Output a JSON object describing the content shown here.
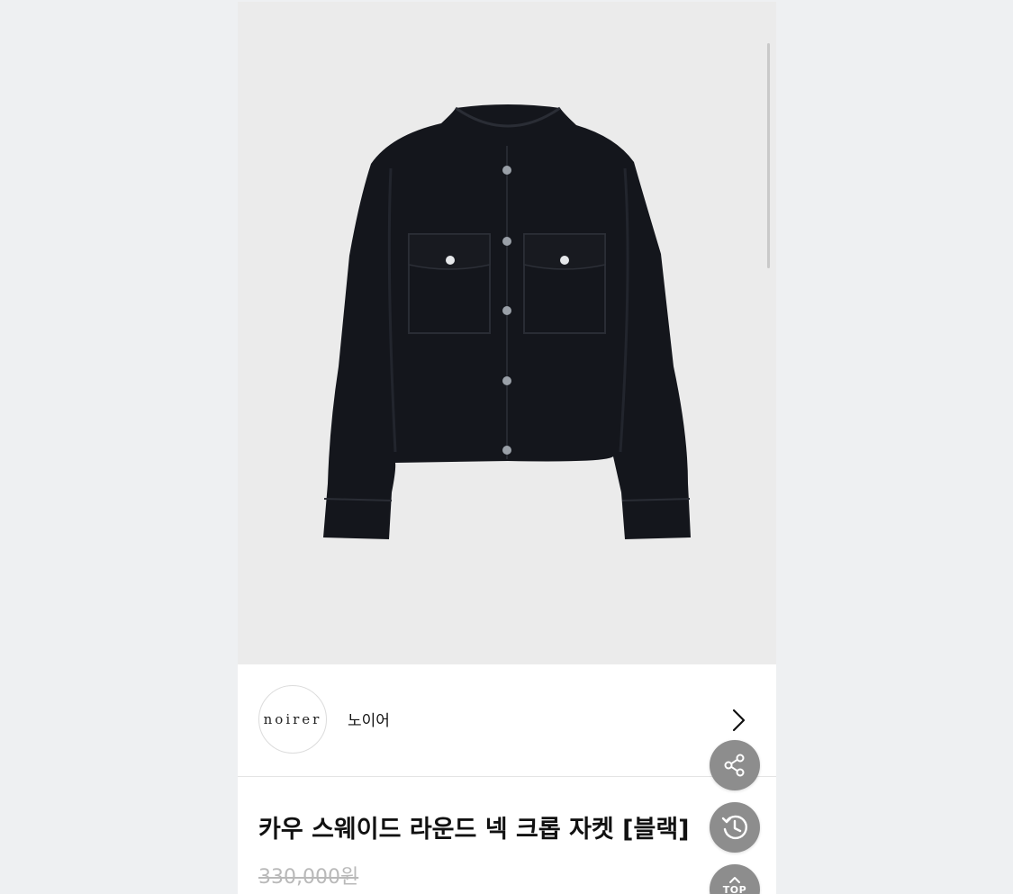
{
  "brand": {
    "logo_text": "noirer",
    "name": "노이어"
  },
  "product": {
    "title": "카우 스웨이드 라운드 넥 크롭 자켓 [블랙]",
    "original_price": "330,000원",
    "image_icon": "black-suede-jacket-image"
  },
  "floating_buttons": {
    "share_icon": "share-icon",
    "history_icon": "history-icon",
    "top_label": "TOP"
  },
  "colors": {
    "image_bg": "#ebebeb",
    "fab_bg": "#8d8d8d",
    "jacket": "#14161c",
    "strikethrough_price": "#b9b9b9"
  }
}
